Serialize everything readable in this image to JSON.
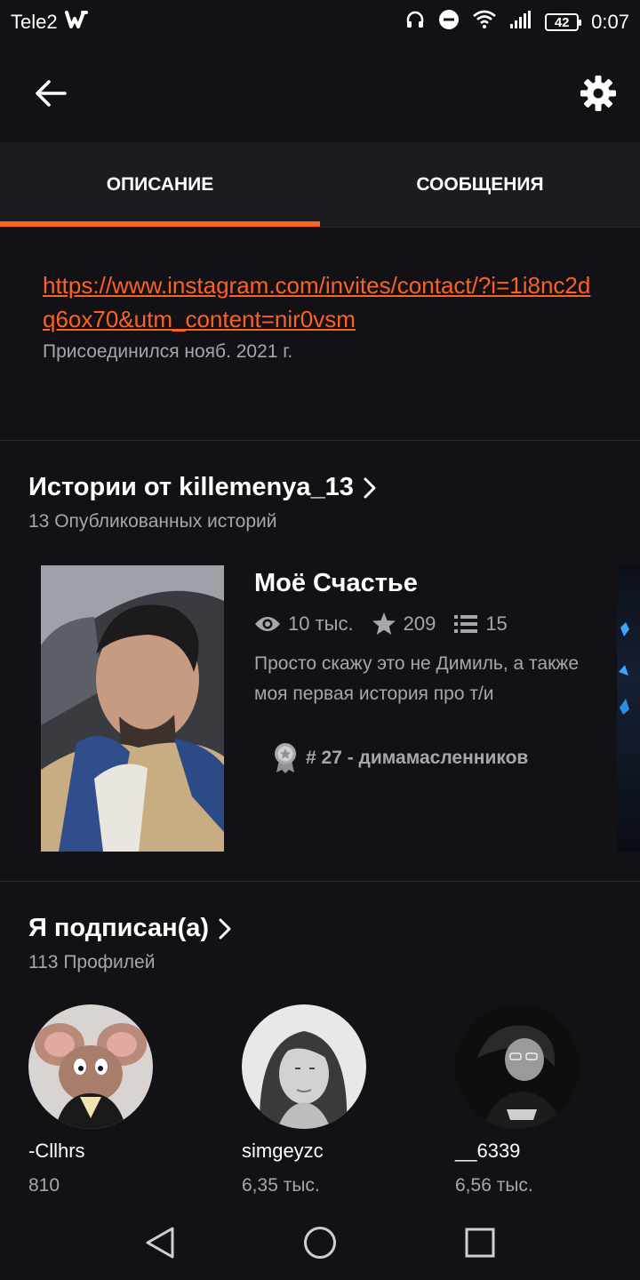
{
  "status_bar": {
    "carrier": "Tele2",
    "battery": "42",
    "time": "0:07"
  },
  "tabs": [
    {
      "label": "ОПИСАНИЕ"
    },
    {
      "label": "СООБЩЕНИЯ"
    }
  ],
  "description": {
    "link": "https://www.instagram.com/invites/contact/?i=1i8nc2dq6ox70&utm_content=nir0vsm",
    "joined": "Присоединился нояб. 2021 г."
  },
  "stories_section": {
    "title": "Истории от killemenya_13",
    "subtitle": "13 Опубликованных историй",
    "story": {
      "title": "Моё Счастье",
      "views": "10 тыс.",
      "stars": "209",
      "parts": "15",
      "description": "Просто скажу это не Димиль, а также  моя первая история про т/и",
      "rank": "# 27 - димамасленников"
    }
  },
  "following_section": {
    "title": "Я подписан(а)",
    "subtitle": "113 Профилей",
    "profiles": [
      {
        "name": "-Cllhrs",
        "count": "810"
      },
      {
        "name": "simgeyzc",
        "count": "6,35 тыс."
      },
      {
        "name": "__6339",
        "count": "6,56 тыс."
      }
    ]
  },
  "colors": {
    "accent": "#ff6122",
    "background": "#121115",
    "secondary_text": "#a7a7ab"
  }
}
